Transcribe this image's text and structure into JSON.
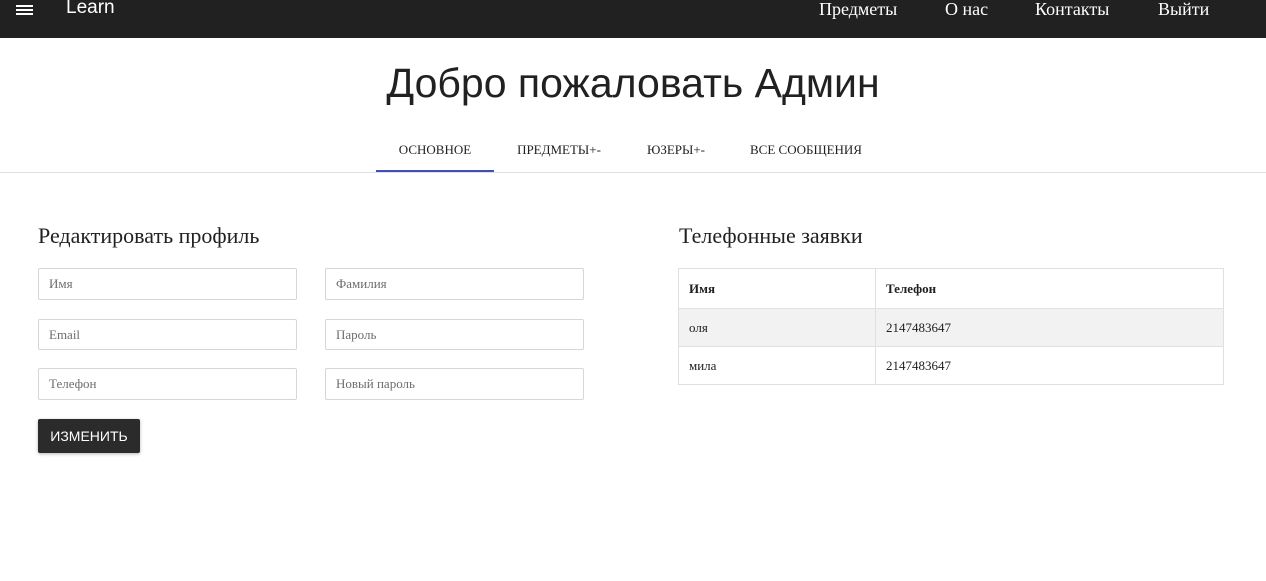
{
  "navbar": {
    "brand": "Learn",
    "links": [
      "Предметы",
      "О нас",
      "Контакты",
      "Выйти"
    ]
  },
  "header": {
    "title": "Добро пожаловать Админ"
  },
  "tabs": [
    "ОСНОВНОЕ",
    "ПРЕДМЕТЫ+-",
    "ЮЗЕРЫ+-",
    "ВСЕ СООБЩЕНИЯ"
  ],
  "active_tab": "ОСНОВНОЕ",
  "profile": {
    "title": "Редактировать профиль",
    "fields": {
      "name": "Имя",
      "surname": "Фамилия",
      "email": "Email",
      "password": "Пароль",
      "phone": "Телефон",
      "new_password": "Новый пароль"
    },
    "submit_label": "ИЗМЕНИТЬ"
  },
  "phone_requests": {
    "title": "Телефонные заявки",
    "columns": [
      "Имя",
      "Телефон"
    ],
    "rows": [
      [
        "оля",
        "2147483647"
      ],
      [
        "мила",
        "2147483647"
      ]
    ]
  },
  "colors": {
    "navbar_bg": "#212121",
    "tab_indicator": "#3f51b5",
    "button_bg": "#2b2b2b"
  }
}
